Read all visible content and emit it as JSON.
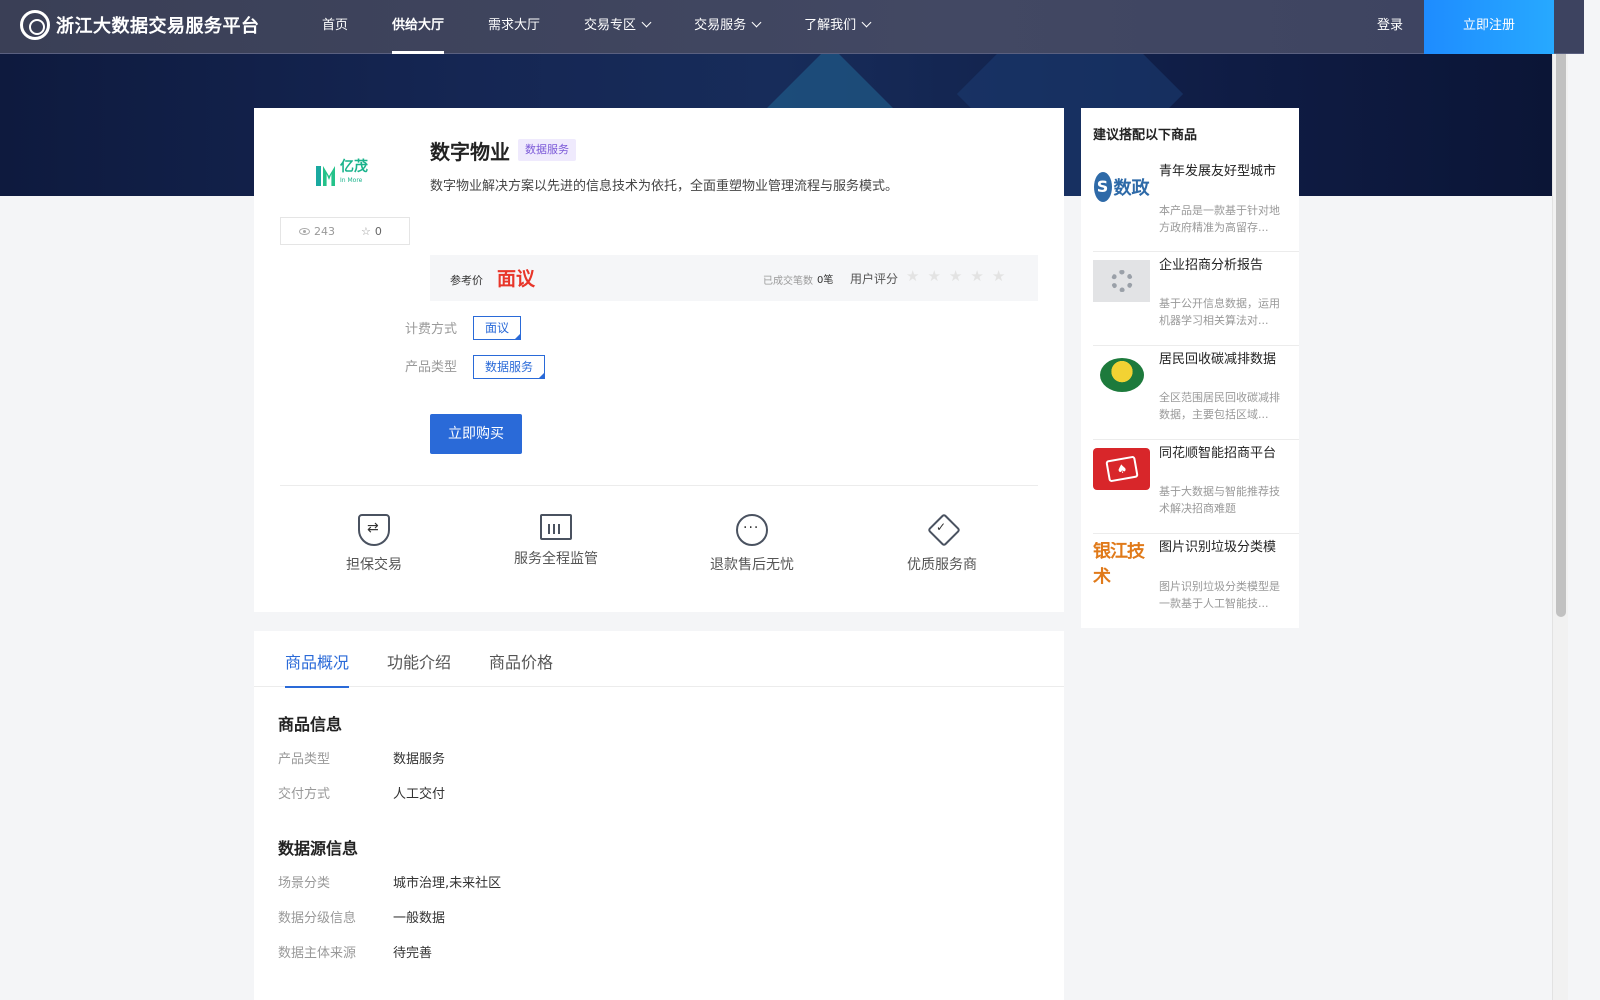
{
  "nav": {
    "brand": "浙江大数据交易服务平台",
    "items": [
      {
        "label": "首页",
        "active": false,
        "dropdown": false
      },
      {
        "label": "供给大厅",
        "active": true,
        "dropdown": false
      },
      {
        "label": "需求大厅",
        "active": false,
        "dropdown": false
      },
      {
        "label": "交易专区",
        "active": false,
        "dropdown": true
      },
      {
        "label": "交易服务",
        "active": false,
        "dropdown": true
      },
      {
        "label": "了解我们",
        "active": false,
        "dropdown": true
      }
    ],
    "login": "登录",
    "register": "立即注册"
  },
  "product": {
    "logo_text": "亿茂",
    "logo_sub": "In More",
    "views": "243",
    "favorites": "0",
    "title": "数字物业",
    "tag": "数据服务",
    "description": "数字物业解决方案以先进的信息技术为依托，全面重塑物业管理流程与服务模式。",
    "price_label": "参考价",
    "price_value": "面议",
    "deal_label": "已成交笔数",
    "deal_value": "0笔",
    "rating_label": "用户评分",
    "rating": 0,
    "billing_label": "计费方式",
    "billing_value": "面议",
    "type_label": "产品类型",
    "type_value": "数据服务",
    "buy_button": "立即购买"
  },
  "features": [
    {
      "label": "担保交易",
      "icon": "shield-icon"
    },
    {
      "label": "服务全程监管",
      "icon": "monitor-icon"
    },
    {
      "label": "退款售后无忧",
      "icon": "chat-icon"
    },
    {
      "label": "优质服务商",
      "icon": "diamond-icon"
    }
  ],
  "tabs": [
    {
      "label": "商品概况",
      "active": true
    },
    {
      "label": "功能介绍",
      "active": false
    },
    {
      "label": "商品价格",
      "active": false
    }
  ],
  "info": {
    "title": "商品信息",
    "rows": [
      {
        "label": "产品类型",
        "value": "数据服务"
      },
      {
        "label": "交付方式",
        "value": "人工交付"
      }
    ]
  },
  "source": {
    "title": "数据源信息",
    "rows": [
      {
        "label": "场景分类",
        "value": "城市治理,未来社区"
      },
      {
        "label": "数据分级信息",
        "value": "一般数据"
      },
      {
        "label": "数据主体来源",
        "value": "待完善"
      }
    ]
  },
  "sidebar": {
    "title": "建议搭配以下商品",
    "items": [
      {
        "name": "青年发展友好型城市",
        "desc": "本产品是一款基于针对地方政府精准为高留存...",
        "thumb_text": "数政"
      },
      {
        "name": "企业招商分析报告",
        "desc": "基于公开信息数据，运用机器学习相关算法对...",
        "thumb_text": ""
      },
      {
        "name": "居民回收碳减排数据",
        "desc": "全区范围居民回收碳减排数据，主要包括区域...",
        "thumb_text": ""
      },
      {
        "name": "同花顺智能招商平台",
        "desc": "基于大数据与智能推荐技术解决招商难题",
        "thumb_text": ""
      },
      {
        "name": "图片识别垃圾分类模",
        "desc": "图片识别垃圾分类模型是一款基于人工智能技...",
        "thumb_text": "银江技术"
      }
    ]
  }
}
